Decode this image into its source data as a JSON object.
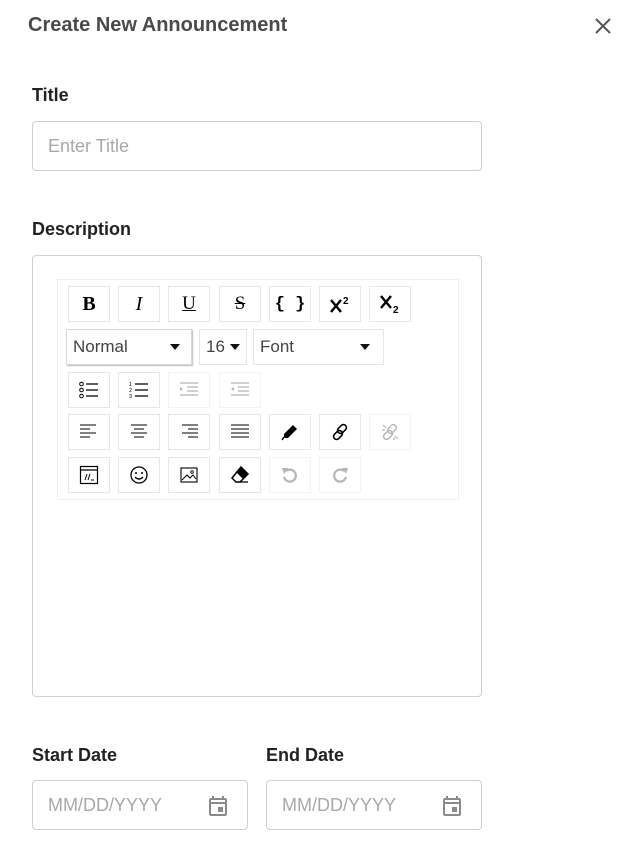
{
  "header": {
    "title": "Create New Announcement",
    "close_icon": "close-icon"
  },
  "title_field": {
    "label": "Title",
    "placeholder": "Enter Title"
  },
  "description": {
    "label": "Description",
    "toolbar": {
      "format_buttons": [
        "bold",
        "italic",
        "underline",
        "strikethrough",
        "code",
        "superscript",
        "subscript"
      ],
      "bold_label": "B",
      "italic_label": "I",
      "underline_label": "U",
      "strikethrough_label": "S",
      "code_label": "{ }",
      "block_type": "Normal",
      "font_size": "16",
      "font_family": "Font",
      "list_buttons": [
        "unordered-list",
        "ordered-list",
        "indent",
        "outdent"
      ],
      "align_buttons": [
        "align-left",
        "align-center",
        "align-right",
        "justify",
        "color-picker",
        "link",
        "unlink"
      ],
      "misc_buttons": [
        "embedded",
        "emoji",
        "image",
        "remove-formatting",
        "undo",
        "redo"
      ]
    }
  },
  "start_date": {
    "label": "Start Date",
    "placeholder": "MM/DD/YYYY"
  },
  "end_date": {
    "label": "End Date",
    "placeholder": "MM/DD/YYYY"
  },
  "colors": {
    "border": "#cfcfcf",
    "placeholder": "#a8a8a8",
    "title": "#4a4a4a",
    "disabled_icon": "#b5b5b5"
  }
}
